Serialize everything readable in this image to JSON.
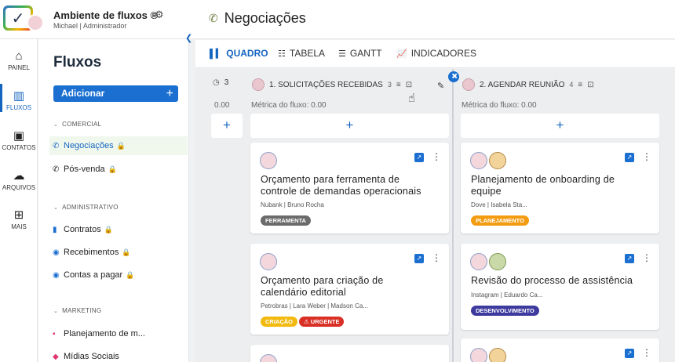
{
  "header": {
    "workspace_name": "Ambiente de fluxos ®",
    "workspace_user": "Michael | Administrador",
    "page_title": "Negociações"
  },
  "rail": {
    "items": [
      {
        "label": "PAINEL",
        "icon": "home-icon"
      },
      {
        "label": "FLUXOS",
        "icon": "flows-icon"
      },
      {
        "label": "CONTATOS",
        "icon": "contacts-icon"
      },
      {
        "label": "ARQUIVOS",
        "icon": "cloud-icon"
      },
      {
        "label": "MAIS",
        "icon": "apps-icon"
      }
    ]
  },
  "sidebar": {
    "title": "Fluxos",
    "add_label": "Adicionar",
    "sections": [
      {
        "label": "COMERCIAL",
        "items": [
          "Negociações",
          "Pós-venda"
        ]
      },
      {
        "label": "ADMINISTRATIVO",
        "items": [
          "Contratos",
          "Recebimentos",
          "Contas a pagar"
        ]
      },
      {
        "label": "MARKETING",
        "items": [
          "Planejamento de m...",
          "Mídias Sociais"
        ]
      }
    ]
  },
  "tabs": [
    "QUADRO",
    "TABELA",
    "GANTT",
    "INDICADORES"
  ],
  "board": {
    "partial_column": {
      "count": "3",
      "metric": "0.00"
    },
    "columns": [
      {
        "title": "1. SOLICITAÇÕES RECEBIDAS",
        "count": "3",
        "metric": "Métrica do fluxo: 0.00",
        "cards": [
          {
            "title_lines": [
              "Orçamento para ferramenta de",
              "controle de demandas operacionais"
            ],
            "meta": "Nubank  |  Bruno Rocha",
            "tags": [
              {
                "label": "FERRAMENTA",
                "color": "#6b6b6b"
              }
            ]
          },
          {
            "title_lines": [
              "Orçamento para criação de",
              "calendário editorial"
            ],
            "meta": "Petrobras  |  Lara Weber  |  Madson Ca...",
            "tags": [
              {
                "label": "CRIAÇÃO",
                "color": "#f2b90f"
              },
              {
                "label": "⚠ URGENTE",
                "color": "#d93025"
              }
            ]
          }
        ]
      },
      {
        "title": "2. AGENDAR REUNIÃO",
        "count": "4",
        "metric": "Métrica do fluxo: 0.00",
        "cards": [
          {
            "title_lines": [
              "Planejamento de onboarding de",
              "equipe"
            ],
            "meta": "Dove  |  Isabela Sta...",
            "tags": [
              {
                "label": "PLANEJAMENTO",
                "color": "#f39c12"
              }
            ]
          },
          {
            "title_lines": [
              "Revisão do processo de assistência"
            ],
            "meta": "Instagram  |  Eduardo Ca...",
            "tags": [
              {
                "label": "DESENVOLVIMENTO",
                "color": "#3d3a9e"
              }
            ]
          }
        ]
      }
    ]
  },
  "colors": {
    "accent": "#1a6fd1",
    "active_nav_bg": "#f0f7ed"
  }
}
